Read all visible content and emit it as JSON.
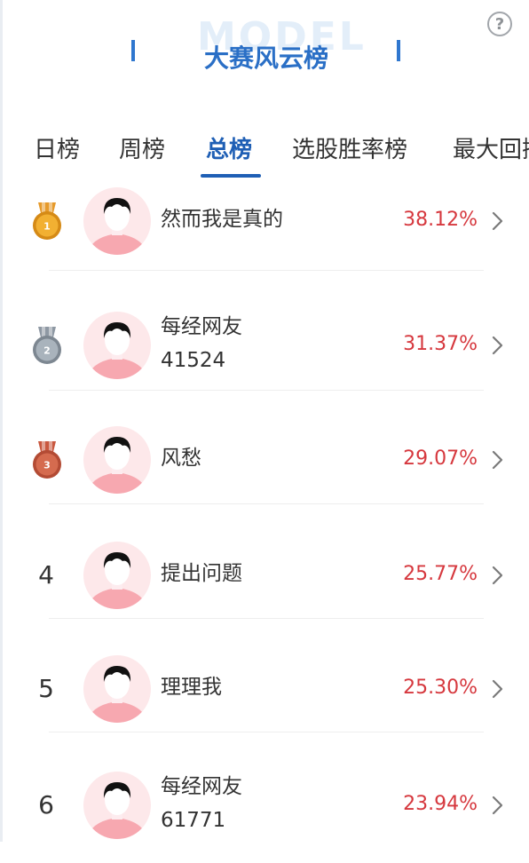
{
  "header": {
    "title": "大赛风云榜",
    "watermark": "MODEL",
    "help_glyph": "?"
  },
  "tabs": [
    {
      "label": "日榜",
      "active": false
    },
    {
      "label": "周榜",
      "active": false
    },
    {
      "label": "总榜",
      "active": true
    },
    {
      "label": "选股胜率榜",
      "active": false
    },
    {
      "label": "最大回撤",
      "active": false
    }
  ],
  "rankings": [
    {
      "rank": "1",
      "medal": "gold-medal-icon",
      "name": [
        "然而我是真的"
      ],
      "return_pct": "38.12%"
    },
    {
      "rank": "2",
      "medal": "silver-medal-icon",
      "name": [
        "每经网友",
        "41524"
      ],
      "return_pct": "31.37%"
    },
    {
      "rank": "3",
      "medal": "bronze-medal-icon",
      "name": [
        "风愁"
      ],
      "return_pct": "29.07%"
    },
    {
      "rank": "4",
      "medal": null,
      "name": [
        "提出问题"
      ],
      "return_pct": "25.77%"
    },
    {
      "rank": "5",
      "medal": null,
      "name": [
        "理理我"
      ],
      "return_pct": "25.30%"
    },
    {
      "rank": "6",
      "medal": null,
      "name": [
        "每经网友",
        "61771"
      ],
      "return_pct": "23.94%"
    }
  ],
  "colors": {
    "accent": "#1f5fb5",
    "title": "#2a6fc6",
    "positive_return": "#d6383e",
    "avatar_bg": "#fde8ea",
    "avatar_shirt": "#f7a8b0"
  }
}
